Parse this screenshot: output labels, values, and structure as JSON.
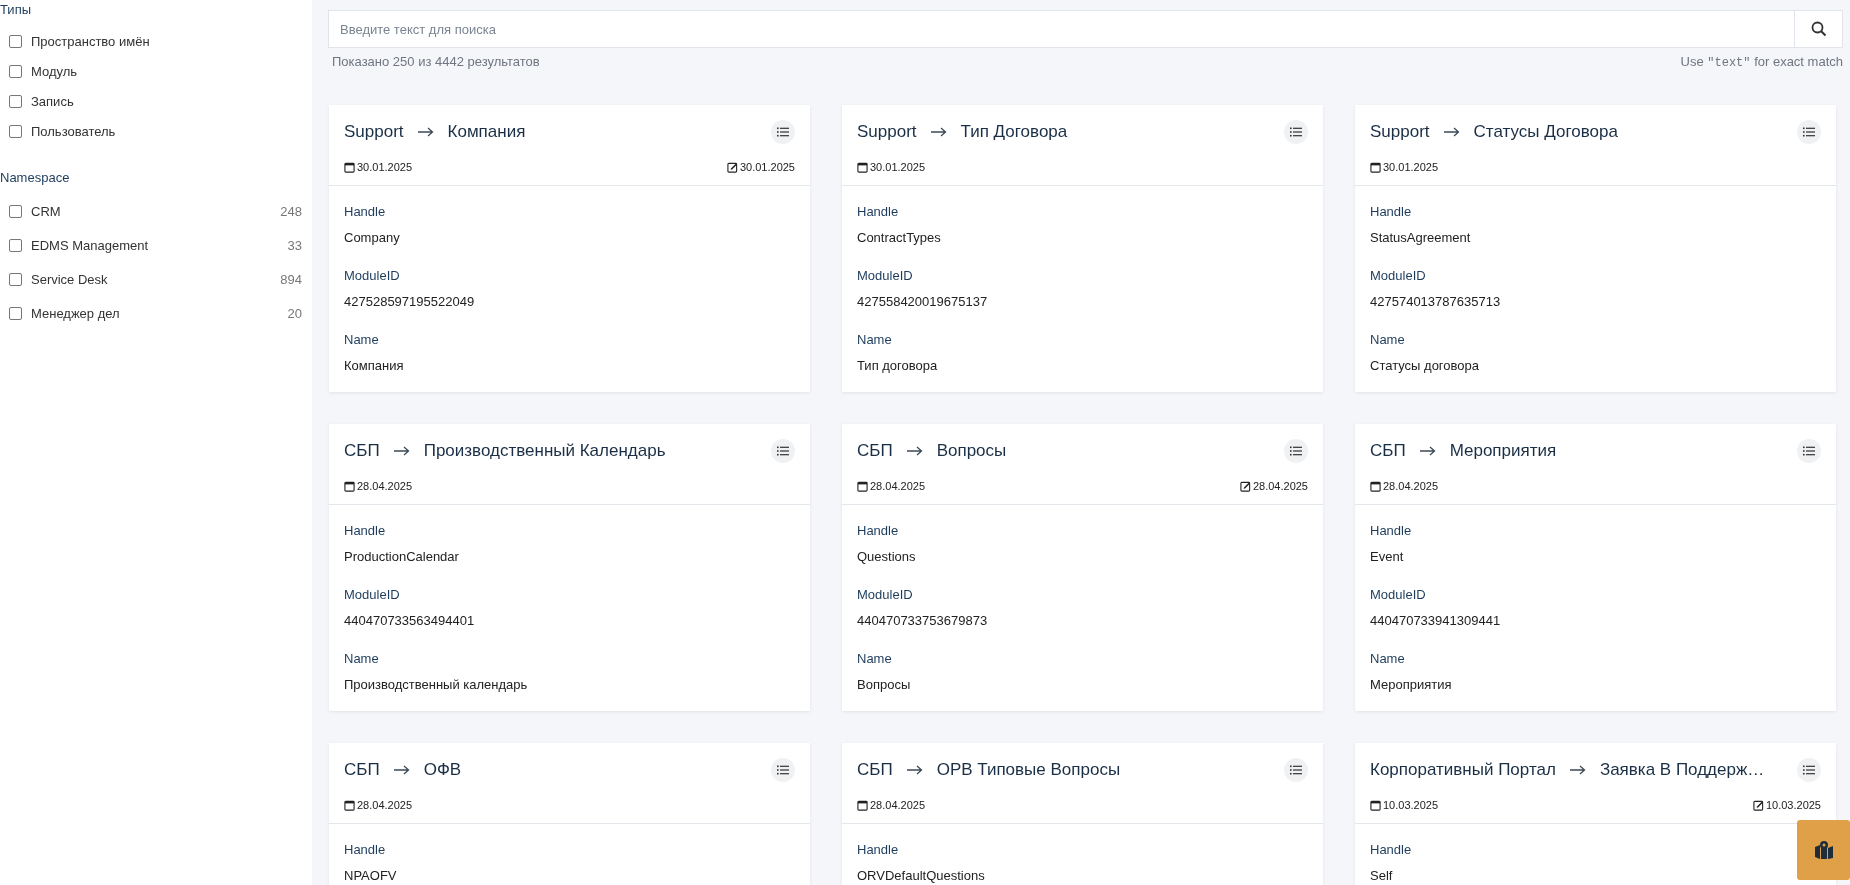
{
  "sidebar": {
    "sections": [
      {
        "title": "Типы",
        "items": [
          {
            "label": "Пространство имён",
            "checked": false
          },
          {
            "label": "Модуль",
            "checked": false
          },
          {
            "label": "Запись",
            "checked": false
          },
          {
            "label": "Пользователь",
            "checked": false
          }
        ]
      },
      {
        "title": "Namespace",
        "items": [
          {
            "label": "CRM",
            "count": "248",
            "checked": false
          },
          {
            "label": "EDMS Management",
            "count": "33",
            "checked": false
          },
          {
            "label": "Service Desk",
            "count": "894",
            "checked": false
          },
          {
            "label": "Менеджер дел",
            "count": "20",
            "checked": false
          }
        ]
      }
    ]
  },
  "search": {
    "placeholder": "Введите текст для поиска",
    "results": "Показано 250 из 4442 результатов",
    "hint": {
      "before": "Use",
      "code": "\"text\"",
      "after": "for exact match"
    }
  },
  "cards": [
    {
      "namespace": "Support",
      "name": "Компания",
      "created": "30.01.2025",
      "edited": "30.01.2025",
      "fields": [
        {
          "label": "Handle",
          "value": "Company"
        },
        {
          "label": "ModuleID",
          "value": "427528597195522049"
        },
        {
          "label": "Name",
          "value": "Компания"
        }
      ]
    },
    {
      "namespace": "Support",
      "name": "Тип Договора",
      "created": "30.01.2025",
      "fields": [
        {
          "label": "Handle",
          "value": "ContractTypes"
        },
        {
          "label": "ModuleID",
          "value": "427558420019675137"
        },
        {
          "label": "Name",
          "value": "Тип договора"
        }
      ]
    },
    {
      "namespace": "Support",
      "name": "Статусы Договора",
      "created": "30.01.2025",
      "fields": [
        {
          "label": "Handle",
          "value": "StatusAgreement"
        },
        {
          "label": "ModuleID",
          "value": "427574013787635713"
        },
        {
          "label": "Name",
          "value": "Статусы договора"
        }
      ]
    },
    {
      "namespace": "СБП",
      "name": "Производственный Календарь",
      "created": "28.04.2025",
      "fields": [
        {
          "label": "Handle",
          "value": "ProductionCalendar"
        },
        {
          "label": "ModuleID",
          "value": "440470733563494401"
        },
        {
          "label": "Name",
          "value": "Производственный календарь"
        }
      ]
    },
    {
      "namespace": "СБП",
      "name": "Вопросы",
      "created": "28.04.2025",
      "edited": "28.04.2025",
      "fields": [
        {
          "label": "Handle",
          "value": "Questions"
        },
        {
          "label": "ModuleID",
          "value": "440470733753679873"
        },
        {
          "label": "Name",
          "value": "Вопросы"
        }
      ]
    },
    {
      "namespace": "СБП",
      "name": "Мероприятия",
      "created": "28.04.2025",
      "fields": [
        {
          "label": "Handle",
          "value": "Event"
        },
        {
          "label": "ModuleID",
          "value": "440470733941309441"
        },
        {
          "label": "Name",
          "value": "Мероприятия"
        }
      ]
    },
    {
      "namespace": "СБП",
      "name": "ОФВ",
      "created": "28.04.2025",
      "fields": [
        {
          "label": "Handle",
          "value": "NPAOFV"
        }
      ]
    },
    {
      "namespace": "СБП",
      "name": "ОРВ Типовые Вопросы",
      "created": "28.04.2025",
      "fields": [
        {
          "label": "Handle",
          "value": "ORVDefaultQuestions"
        }
      ]
    },
    {
      "namespace": "Корпоративный Портал",
      "name": "Заявка В Поддерж…",
      "created": "10.03.2025",
      "edited": "10.03.2025",
      "fields": [
        {
          "label": "Handle",
          "value": "Self"
        }
      ]
    }
  ]
}
